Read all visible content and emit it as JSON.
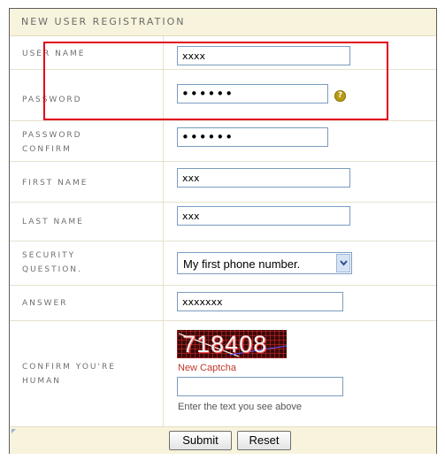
{
  "form": {
    "title": "NEW USER REGISTRATION",
    "fields": {
      "username": {
        "label": "USER NAME",
        "value": "xxxx"
      },
      "password": {
        "label": "PASSWORD",
        "value": "••••••",
        "help_icon": "question-icon"
      },
      "password_confirm": {
        "label_line1": "PASSWORD",
        "label_line2": "CONFIRM",
        "value": "••••••"
      },
      "first_name": {
        "label": "FIRST NAME",
        "value": "xxx"
      },
      "last_name": {
        "label": "LAST NAME",
        "value": "xxx"
      },
      "security_question": {
        "label_line1": "SECURITY",
        "label_line2": "QUESTION.",
        "selected": "My first phone number."
      },
      "answer": {
        "label": "ANSWER",
        "value": "xxxxxxx"
      },
      "captcha": {
        "label_line1": "CONFIRM YOU'RE",
        "label_line2": "HUMAN",
        "image_text": "718408",
        "new_link": "New Captcha",
        "input_value": "",
        "help_text": "Enter the text you see above"
      }
    },
    "buttons": {
      "submit": "Submit",
      "reset": "Reset"
    }
  },
  "colors": {
    "header_bg": "#f7f3dc",
    "highlight": "#e0001c",
    "link": "#c0392b",
    "input_border": "#7a9cc0"
  }
}
